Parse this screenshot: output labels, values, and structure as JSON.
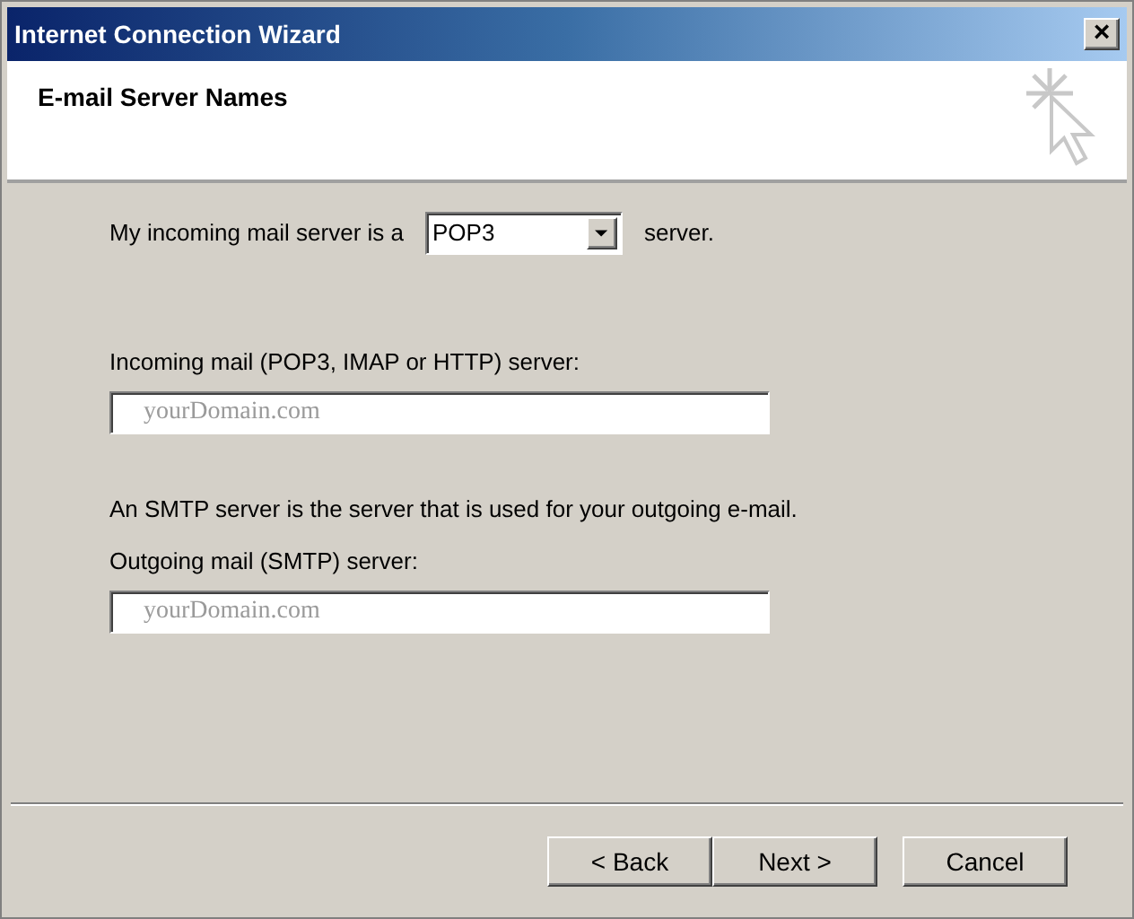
{
  "window": {
    "title": "Internet Connection Wizard",
    "close": "×"
  },
  "header": {
    "title": "E-mail Server Names"
  },
  "server_type": {
    "label_before": "My incoming mail server is a",
    "value": "POP3",
    "label_after": "server."
  },
  "incoming": {
    "label": "Incoming mail (POP3, IMAP or HTTP) server:",
    "placeholder": "yourDomain.com"
  },
  "smtp_note": "An SMTP server is the server that is used for your outgoing e-mail.",
  "outgoing": {
    "label": "Outgoing mail (SMTP) server:",
    "placeholder": "yourDomain.com"
  },
  "buttons": [
    {
      "label": "< Back"
    },
    {
      "label": "Next >"
    },
    {
      "label": "Cancel"
    }
  ]
}
